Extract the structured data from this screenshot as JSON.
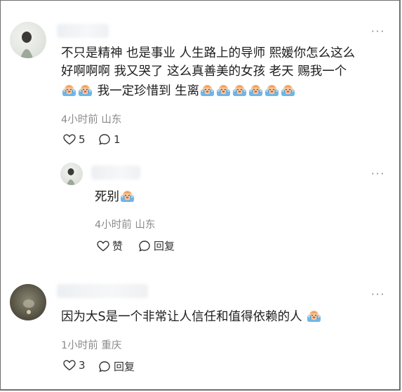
{
  "comments": [
    {
      "text_line1": "不只是精神 也是事业 人生路上的导师 熙媛你怎么这么",
      "text_line2": "好啊啊啊 我又哭了 这么真善美的女孩 老天 赐我一个",
      "text_line3a": "我一定珍惜到 生离",
      "time": "4小时前",
      "location": "山东",
      "likes": "5",
      "replies": "1",
      "emoji": "crying-emoji"
    },
    {
      "text": "死别",
      "time": "4小时前",
      "location": "山东",
      "like_label": "赞",
      "reply_label": "回复"
    },
    {
      "text": "因为大S是一个非常让人信任和值得依赖的人",
      "time": "1小时前",
      "location": "重庆",
      "likes": "3",
      "reply_label": "回复"
    }
  ],
  "icons": {
    "more": "more-dots-icon",
    "like": "heart-icon",
    "reply": "comment-bubble-icon"
  },
  "colors": {
    "text": "#1c1c1c",
    "meta": "#8a8a8a",
    "icon": "#333333",
    "border": "#6f6f6f"
  }
}
